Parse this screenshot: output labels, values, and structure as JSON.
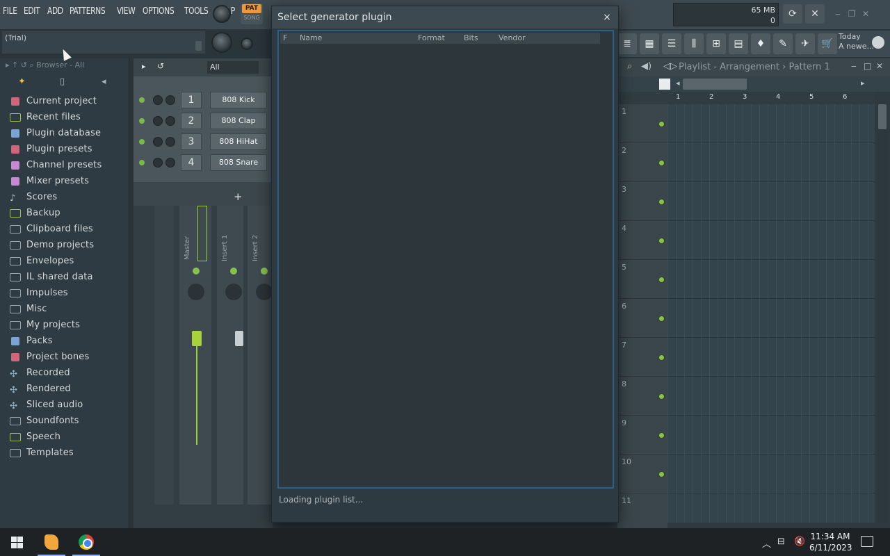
{
  "menu": {
    "items": [
      "FILE",
      "EDIT",
      "ADD",
      "PATTERNS",
      "VIEW",
      "OPTIONS",
      "TOOLS",
      "HELP"
    ]
  },
  "hint_bar": {
    "text": "(Trial)"
  },
  "transport": {
    "pat_label": "PAT",
    "song_label": "SONG"
  },
  "memory": {
    "value": "65 MB",
    "secondary": "0"
  },
  "news": {
    "line1": "Today",
    "line2": "A newe..."
  },
  "browser": {
    "title": "Browser - All",
    "items": [
      {
        "label": "Current project",
        "icon": "project-icon"
      },
      {
        "label": "Recent files",
        "icon": "recent-files-icon"
      },
      {
        "label": "Plugin database",
        "icon": "plugin-database-icon"
      },
      {
        "label": "Plugin presets",
        "icon": "plugin-presets-icon"
      },
      {
        "label": "Channel presets",
        "icon": "channel-presets-icon"
      },
      {
        "label": "Mixer presets",
        "icon": "mixer-presets-icon"
      },
      {
        "label": "Scores",
        "icon": "note-icon"
      },
      {
        "label": "Backup",
        "icon": "backup-folder-icon"
      },
      {
        "label": "Clipboard files",
        "icon": "folder-icon"
      },
      {
        "label": "Demo projects",
        "icon": "folder-icon"
      },
      {
        "label": "Envelopes",
        "icon": "folder-icon"
      },
      {
        "label": "IL shared data",
        "icon": "folder-icon"
      },
      {
        "label": "Impulses",
        "icon": "folder-icon"
      },
      {
        "label": "Misc",
        "icon": "folder-icon"
      },
      {
        "label": "My projects",
        "icon": "folder-icon"
      },
      {
        "label": "Packs",
        "icon": "packs-icon"
      },
      {
        "label": "Project bones",
        "icon": "project-bones-icon"
      },
      {
        "label": "Recorded",
        "icon": "recorded-icon"
      },
      {
        "label": "Rendered",
        "icon": "rendered-icon"
      },
      {
        "label": "Sliced audio",
        "icon": "sliced-audio-icon"
      },
      {
        "label": "Soundfonts",
        "icon": "folder-icon"
      },
      {
        "label": "Speech",
        "icon": "speech-icon"
      },
      {
        "label": "Templates",
        "icon": "folder-icon"
      }
    ]
  },
  "channel_rack": {
    "filter": "All",
    "channels": [
      {
        "num": "1",
        "name": "808 Kick"
      },
      {
        "num": "2",
        "name": "808 Clap"
      },
      {
        "num": "3",
        "name": "808 HiHat"
      },
      {
        "num": "4",
        "name": "808 Snare"
      }
    ],
    "add_label": "+"
  },
  "mixer": {
    "strips": [
      "Master",
      "Insert 1",
      "Insert 2"
    ]
  },
  "playlist": {
    "title": "Playlist - Arrangement",
    "pattern": "Pattern 1",
    "ruler": [
      "1",
      "2",
      "3",
      "4",
      "5",
      "6"
    ],
    "tracks": [
      "1",
      "2",
      "3",
      "4",
      "5",
      "6",
      "7",
      "8",
      "9",
      "10",
      "11"
    ]
  },
  "dialog": {
    "title": "Select generator plugin",
    "close": "×",
    "columns": {
      "f": "F",
      "name": "Name",
      "format": "Format",
      "bits": "Bits",
      "vendor": "Vendor"
    },
    "status": "Loading plugin list..."
  },
  "taskbar": {
    "time": "11:34 AM",
    "date": "6/11/2023"
  }
}
